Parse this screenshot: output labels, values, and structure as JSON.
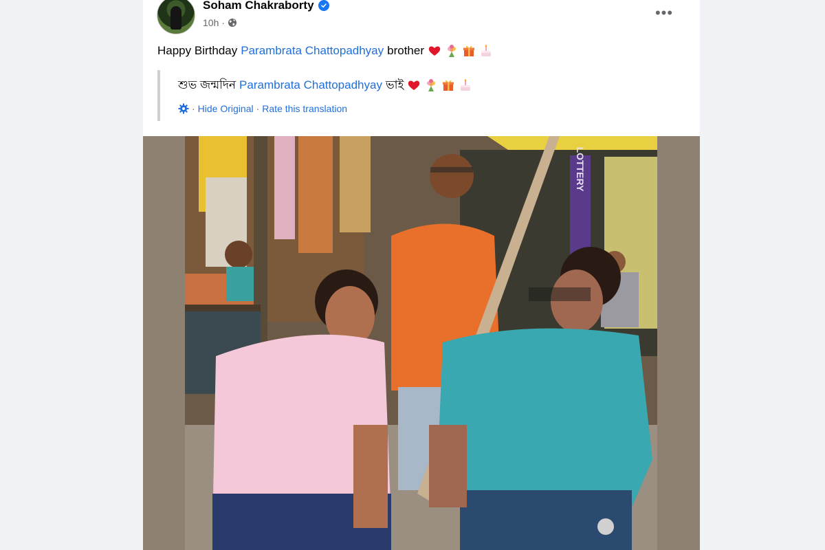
{
  "post": {
    "author": {
      "name": "Soham Chakraborty",
      "verified": true
    },
    "meta": {
      "time": "10h",
      "separator": "·"
    },
    "more_label": "•••",
    "text": {
      "prefix": "Happy Birthday",
      "mention": "Parambrata Chattopadhyay",
      "suffix": "brother"
    },
    "translation": {
      "original_prefix": "শুভ জন্মদিন",
      "mention": "Parambrata Chattopadhyay",
      "original_suffix": "ভাই",
      "actions": {
        "separator": "·",
        "hide_original": "Hide Original",
        "rate": "Rate this translation"
      }
    },
    "photo": {
      "sign_text": "LOTTERY"
    }
  },
  "colors": {
    "link": "#216fdb",
    "verified": "#1877f2",
    "muted": "#65676b",
    "background": "#f0f2f5"
  },
  "icons": [
    "verified-badge-icon",
    "globe-icon",
    "more-options-icon",
    "heart-emoji",
    "bouquet-emoji",
    "gift-emoji",
    "cake-emoji",
    "gear-icon"
  ]
}
